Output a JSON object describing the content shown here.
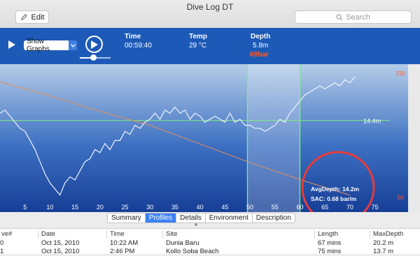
{
  "window": {
    "title": "Dive Log DT"
  },
  "toolbar": {
    "edit_label": "Edit",
    "search_placeholder": "Search"
  },
  "controls": {
    "graph_select": "Show Graphs",
    "playback_progress": 0.45,
    "time_label": "Time",
    "time_value": "00:59:40",
    "temp_label": "Temp",
    "temp_value": "29 °C",
    "depth_label": "Depth",
    "depth_value": "5.8m",
    "pressure_value": "69bar"
  },
  "colors": {
    "accent": "#1d5ab7",
    "pressure": "#ff5a2a",
    "marker": "#7cf07c",
    "annotation_ring": "#e83b3b"
  },
  "chart_data": {
    "type": "line",
    "x_ticks": [
      "5",
      "10",
      "15",
      "20",
      "25",
      "30",
      "35",
      "40",
      "45",
      "50",
      "55",
      "60",
      "65",
      "70",
      "75"
    ],
    "xlim": [
      0,
      78
    ],
    "right_axis_ticks": [
      "210",
      "50"
    ],
    "current_depth_label": "14.4m",
    "selection": {
      "start": 49.5,
      "end": 60
    },
    "stats": {
      "avg_depth": "AvgDepth: 14.2m",
      "sac": "SAC:  0.68 bar/m"
    },
    "series": [
      {
        "values_x": [
          0,
          1,
          2,
          3,
          4,
          5,
          6,
          7,
          8,
          9,
          10,
          11,
          12,
          13,
          14,
          15,
          16,
          17,
          18,
          19,
          20,
          21,
          22,
          23,
          24,
          25,
          26,
          27,
          28,
          29,
          30,
          31,
          32,
          33,
          34,
          35,
          36,
          37,
          38,
          39,
          40,
          41,
          42,
          43,
          44,
          45,
          46,
          47,
          48,
          49,
          50,
          51,
          52,
          53,
          54,
          55,
          56,
          57,
          58,
          59,
          60,
          61,
          62,
          63,
          64,
          65,
          66,
          67,
          68,
          69,
          70,
          71
        ],
        "values_y": [
          -12,
          -11,
          -13,
          -15,
          -17,
          -18,
          -21,
          -24,
          -28,
          -32,
          -35,
          -37,
          -39,
          -35,
          -33,
          -34,
          -31,
          -28,
          -27,
          -24,
          -25,
          -22,
          -24,
          -21,
          -21,
          -18,
          -19,
          -16,
          -17,
          -15,
          -14,
          -12,
          -14,
          -11,
          -12,
          -10,
          -12,
          -11,
          -14,
          -12,
          -13,
          -15,
          -14,
          -13,
          -14,
          -15,
          -12,
          -15,
          -14,
          -16,
          -16,
          -17,
          -17,
          -18,
          -17,
          -16,
          -14,
          -15,
          -12,
          -10,
          -8,
          -6,
          -5,
          -4,
          -3,
          -4,
          -3,
          -2,
          -3,
          -1,
          -2,
          0
        ]
      },
      {
        "values_x": [
          0,
          10,
          20,
          30,
          40,
          50,
          60,
          70
        ],
        "values_y": [
          198,
          180,
          160,
          142,
          118,
          94,
          72,
          52
        ]
      }
    ]
  },
  "tabs": [
    "Summary",
    "Profiles",
    "Details",
    "Environment",
    "Description"
  ],
  "active_tab": "Profiles",
  "table": {
    "headers": [
      "ve#",
      "Date",
      "Time",
      "Site",
      "Length",
      "MaxDepth"
    ],
    "rows": [
      [
        "0",
        "Oct 15, 2010",
        "10:22 AM",
        "Dunia Baru",
        "67 mins",
        "20.2 m"
      ],
      [
        "1",
        "Oct 15, 2010",
        "2:46 PM",
        "Kollo Soba Beach",
        "75 mins",
        "13.7 m"
      ]
    ]
  }
}
